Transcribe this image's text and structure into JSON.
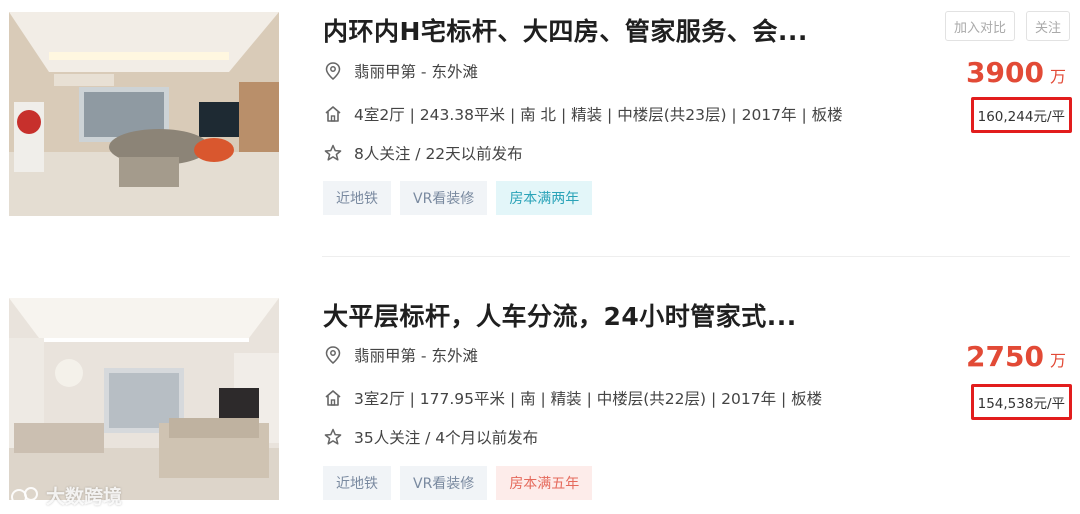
{
  "listings": [
    {
      "title": "内环内H宅标杆、大四房、管家服务、会...",
      "location": "翡丽甲第 - 东外滩",
      "info": "4室2厅 | 243.38平米 | 南 北 | 精装 | 中楼层(共23层) | 2017年 | 板楼",
      "follow": "8人关注 / 22天以前发布",
      "tags": [
        "近地铁",
        "VR看装修",
        "房本满两年"
      ],
      "total_price": "3900",
      "total_unit": "万",
      "unit_price": "160,244元/平"
    },
    {
      "title": "大平层标杆，人车分流，24小时管家式...",
      "location": "翡丽甲第 - 东外滩",
      "info": "3室2厅 | 177.95平米 | 南 | 精装 | 中楼层(共22层) | 2017年 | 板楼",
      "follow": "35人关注 / 4个月以前发布",
      "tags": [
        "近地铁",
        "VR看装修",
        "房本满五年"
      ],
      "total_price": "2750",
      "total_unit": "万",
      "unit_price": "154,538元/平"
    }
  ],
  "actions": {
    "compare": "加入对比",
    "follow": "关注"
  },
  "watermark": "大数跨境",
  "icons": {
    "location": "location-pin-icon",
    "house": "house-icon",
    "star": "star-icon"
  },
  "colors": {
    "price": "#e24a36",
    "highlight_border": "#e21d1d",
    "tag_cyan": "#2aa3b8",
    "tag_pink": "#e56a5c"
  }
}
